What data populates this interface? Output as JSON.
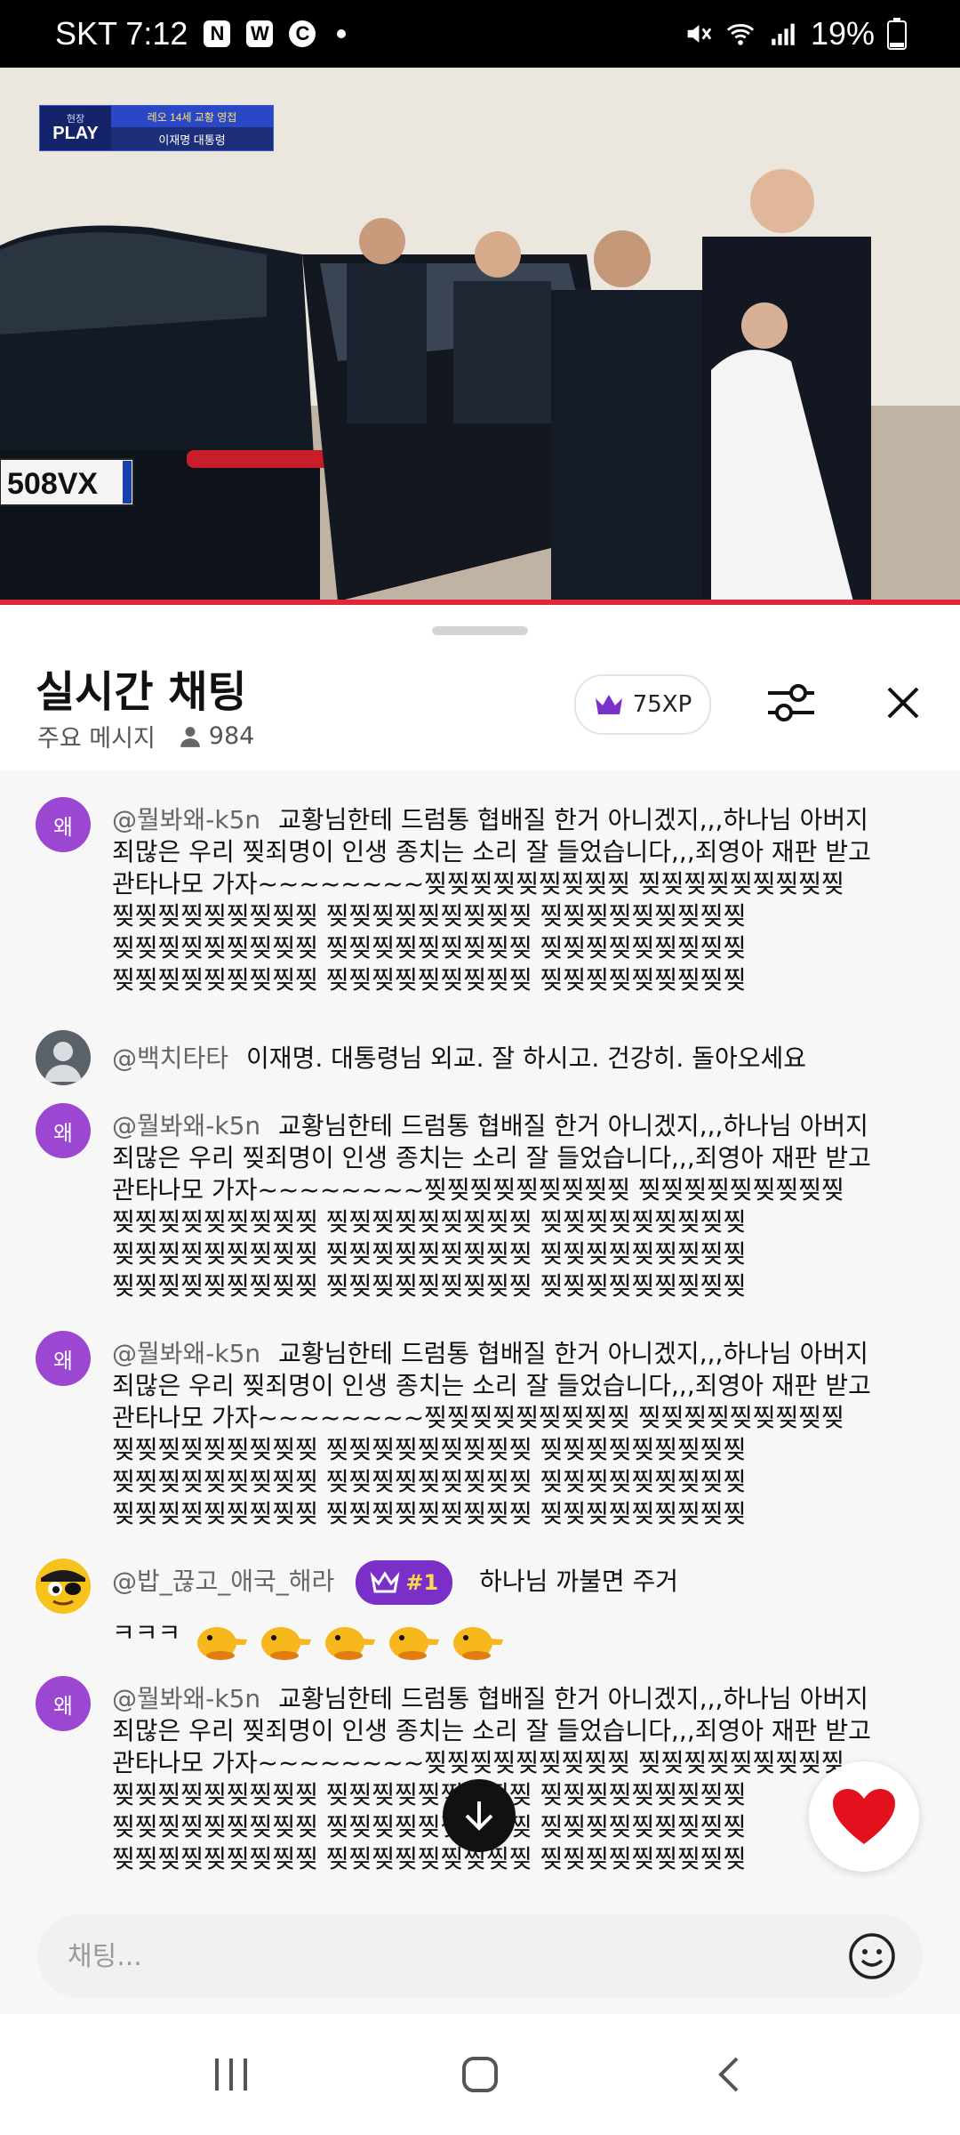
{
  "status_bar": {
    "carrier_time": "SKT 7:12",
    "badges": [
      "N",
      "W",
      "C"
    ],
    "battery": "19%"
  },
  "video": {
    "badge_small": "현장",
    "badge_play": "PLAY",
    "badge_top": "레오 14세 교황 영접",
    "badge_bottom": "이재명 대통령",
    "plate": "508VX"
  },
  "header": {
    "title": "실시간 채팅",
    "subtitle": "주요 메시지",
    "viewer_count": "984",
    "xp": "75XP"
  },
  "messages": [
    {
      "author": "@뭘봐왜-k5n",
      "avatar_text": "왜",
      "lines": [
        "교황님한테 드럼통 협배질 한거 아니겠지,,,하나님 아버지",
        "죄많은 우리 찢죄명이 인생 종치는 소리 잘 들었습니다,,,죄영아 재판 받고",
        "관타나모 가자~~~~~~~~찢찢찢찢찢찢찢찢찢 찢찢찢찢찢찢찢찢찢",
        "찢찢찢찢찢찢찢찢찢 찢찢찢찢찢찢찢찢찢 찢찢찢찢찢찢찢찢찢",
        "찢찢찢찢찢찢찢찢찢 찢찢찢찢찢찢찢찢찢 찢찢찢찢찢찢찢찢찢",
        "찢찢찢찢찢찢찢찢찢 찢찢찢찢찢찢찢찢찢 찢찢찢찢찢찢찢찢찢"
      ]
    },
    {
      "author": "@백치타타",
      "text": "이재명. 대통령님 외교. 잘 하시고. 건강히. 돌아오세요"
    },
    {
      "author": "@뭘봐왜-k5n",
      "avatar_text": "왜",
      "lines": [
        "교황님한테 드럼통 협배질 한거 아니겠지,,,하나님 아버지",
        "죄많은 우리 찢죄명이 인생 종치는 소리 잘 들었습니다,,,죄영아 재판 받고",
        "관타나모 가자~~~~~~~~찢찢찢찢찢찢찢찢찢 찢찢찢찢찢찢찢찢찢",
        "찢찢찢찢찢찢찢찢찢 찢찢찢찢찢찢찢찢찢 찢찢찢찢찢찢찢찢찢",
        "찢찢찢찢찢찢찢찢찢 찢찢찢찢찢찢찢찢찢 찢찢찢찢찢찢찢찢찢",
        "찢찢찢찢찢찢찢찢찢 찢찢찢찢찢찢찢찢찢 찢찢찢찢찢찢찢찢찢"
      ]
    },
    {
      "author": "@뭘봐왜-k5n",
      "avatar_text": "왜",
      "lines": [
        "교황님한테 드럼통 협배질 한거 아니겠지,,,하나님 아버지",
        "죄많은 우리 찢죄명이 인생 종치는 소리 잘 들었습니다,,,죄영아 재판 받고",
        "관타나모 가자~~~~~~~~찢찢찢찢찢찢찢찢찢 찢찢찢찢찢찢찢찢찢",
        "찢찢찢찢찢찢찢찢찢 찢찢찢찢찢찢찢찢찢 찢찢찢찢찢찢찢찢찢",
        "찢찢찢찢찢찢찢찢찢 찢찢찢찢찢찢찢찢찢 찢찢찢찢찢찢찢찢찢",
        "찢찢찢찢찢찢찢찢찢 찢찢찢찢찢찢찢찢찢 찢찢찢찢찢찢찢찢찢"
      ]
    },
    {
      "author": "@밥_끊고_애국_해라",
      "badge": "#1",
      "text": "하나님 까불면 주거",
      "text2": "ㅋㅋㅋ"
    },
    {
      "author": "@뭘봐왜-k5n",
      "avatar_text": "왜",
      "lines": [
        "교황님한테 드럼통 협배질 한거 아니겠지,,,하나님 아버지",
        "죄많은 우리 찢죄명이 인생 종치는 소리 잘 들었습니다,,,죄영아 재판 받고",
        "관타나모 가자~~~~~~~~찢찢찢찢찢찢찢찢찢 찢찢찢찢찢찢찢찢찢",
        "찢찢찢찢찢찢찢찢찢 찢찢찢찢찢찢찢찢찢 찢찢찢찢찢찢찢찢찢",
        "찢찢찢찢찢찢찢찢찢 찢찢찢찢찢찢찢찢찢 찢찢찢찢찢찢찢찢찢",
        "찢찢찢찢찢찢찢찢찢 찢찢찢찢찢찢찢찢찢 찢찢찢찢찢찢찢찢찢"
      ]
    }
  ],
  "input": {
    "placeholder": "채팅..."
  },
  "colors": {
    "accent": "#7b2fc9",
    "progress": "#e0263b",
    "avatar": "#9c47d1"
  }
}
